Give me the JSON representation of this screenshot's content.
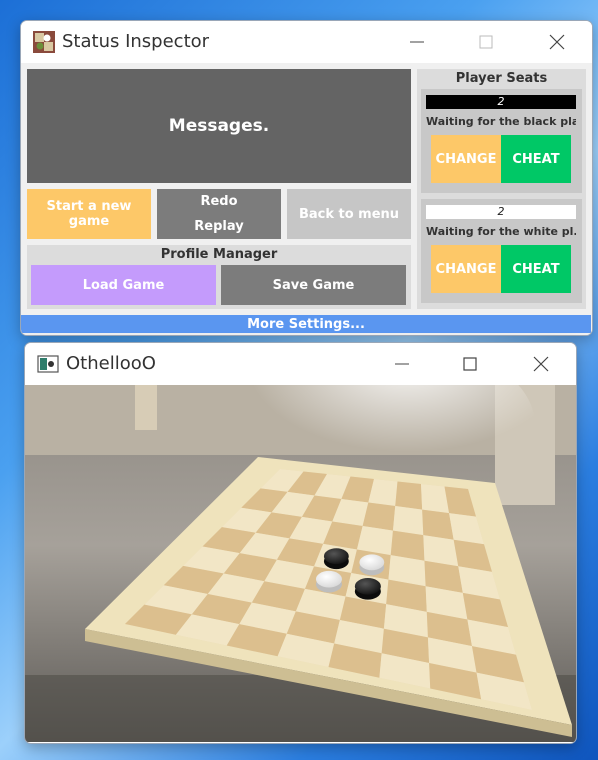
{
  "inspector_window": {
    "title": "Status Inspector"
  },
  "main_panel": {
    "messages": "Messages.",
    "start_new_game": "Start a new game",
    "redo": "Redo",
    "replay": "Replay",
    "back_to_menu": "Back to menu"
  },
  "profile_manager": {
    "title": "Profile Manager",
    "load_game": "Load Game",
    "save_game": "Save Game"
  },
  "player_seats": {
    "title": "Player Seats",
    "seats": [
      {
        "color": "black",
        "count": "2",
        "status": "Waiting for the black pla...",
        "change_label": "CHANGE",
        "cheat_label": "CHEAT"
      },
      {
        "color": "white",
        "count": "2",
        "status": "Waiting for the white pl...",
        "change_label": "CHANGE",
        "cheat_label": "CHEAT"
      }
    ]
  },
  "more_settings": "More Settings...",
  "game_window": {
    "title": "OthellooO",
    "board": {
      "size": 8,
      "pieces": [
        {
          "row": 3,
          "col": 3,
          "color": "black"
        },
        {
          "row": 3,
          "col": 4,
          "color": "white"
        },
        {
          "row": 4,
          "col": 3,
          "color": "white"
        },
        {
          "row": 4,
          "col": 4,
          "color": "black"
        }
      ]
    }
  },
  "colors": {
    "messages_bg": "#646464",
    "start_button": "#fdc868",
    "redo_button": "#7c7c7c",
    "back_button": "#c6c6c6",
    "load_button": "#c49bfc",
    "save_button": "#7c7c7c",
    "change_button": "#fdc868",
    "cheat_button": "#00c866",
    "more_settings_bar": "#5a96f0"
  }
}
